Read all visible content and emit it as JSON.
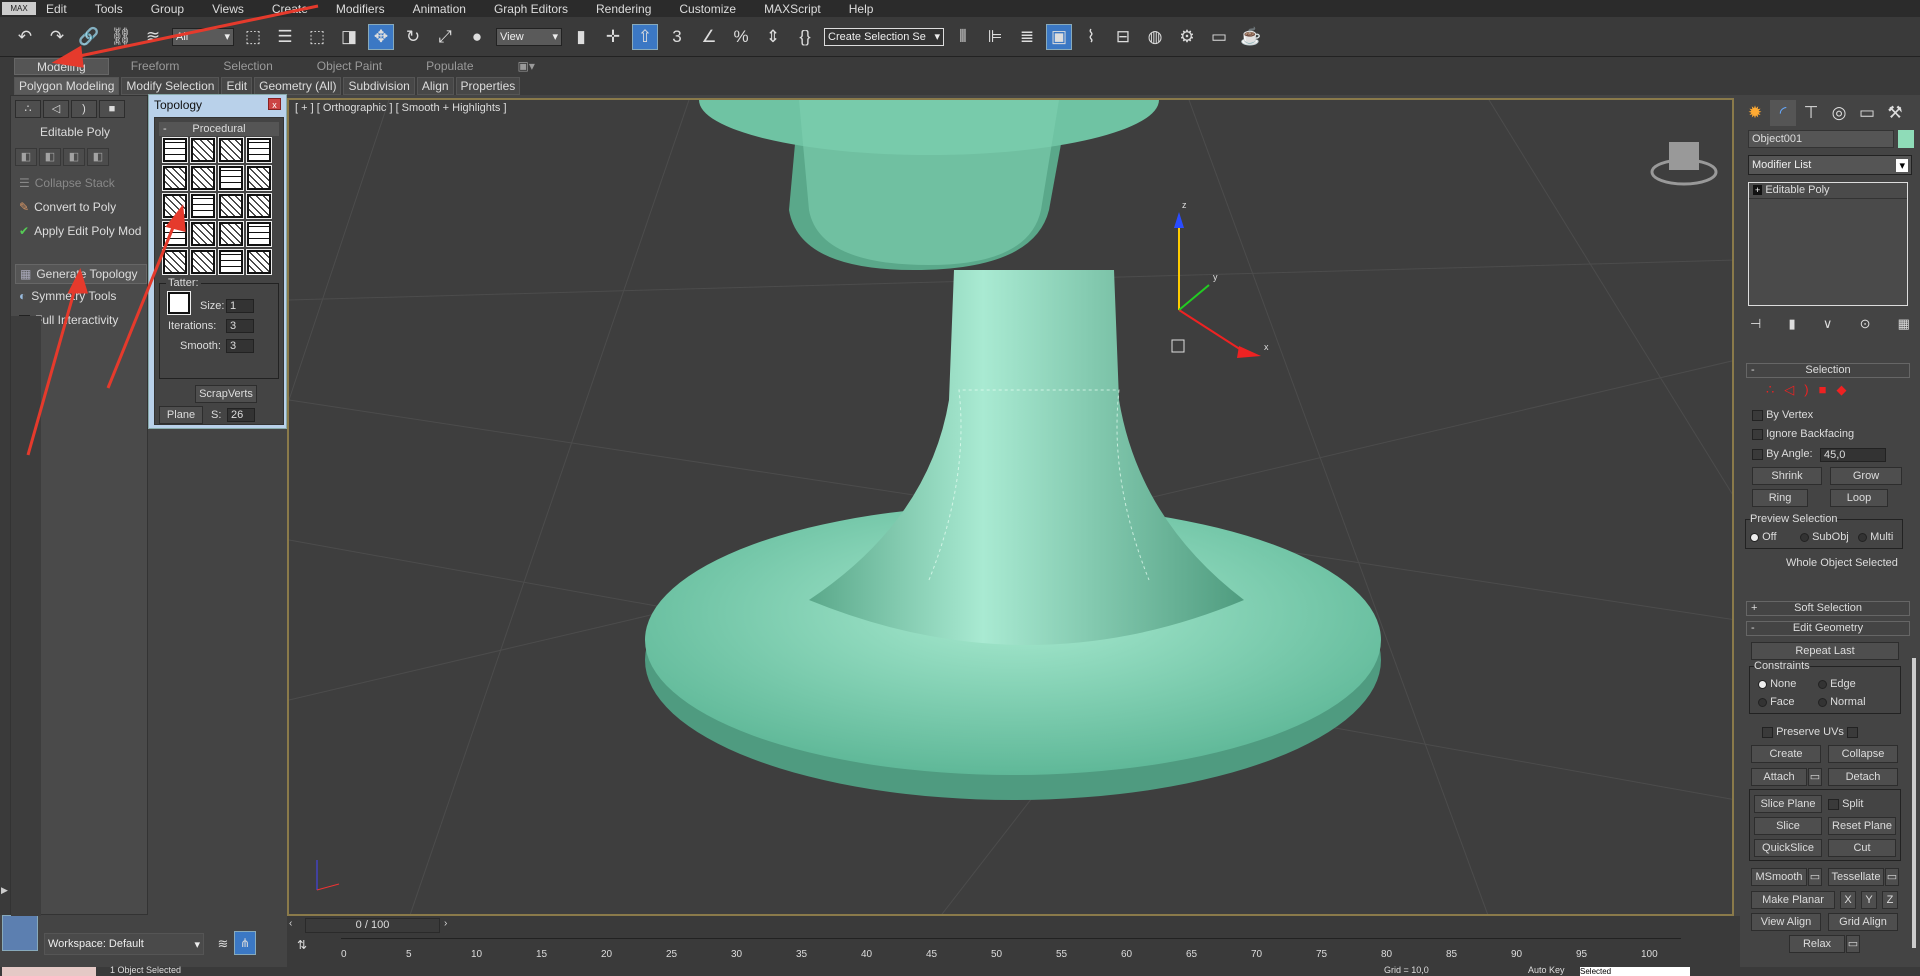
{
  "menubar": {
    "logo": "MAX",
    "items": [
      "Edit",
      "Tools",
      "Group",
      "Views",
      "Create",
      "Modifiers",
      "Animation",
      "Graph Editors",
      "Rendering",
      "Customize",
      "MAXScript",
      "Help"
    ]
  },
  "toolbar": {
    "filter_value": "All",
    "coord_value": "View",
    "selection_set_placeholder": "Create Selection Se"
  },
  "ribbon": {
    "tabs": [
      "Modeling",
      "Freeform",
      "Selection",
      "Object Paint",
      "Populate"
    ],
    "active_tab": "Modeling",
    "subtabs": [
      "Polygon Modeling",
      "Modify Selection",
      "Edit",
      "Geometry (All)",
      "Subdivision",
      "Align",
      "Properties"
    ]
  },
  "left_panel": {
    "title": "Editable Poly",
    "items": [
      "Collapse Stack",
      "Convert to Poly",
      "Apply Edit Poly Mod",
      "Generate Topology",
      "Symmetry Tools",
      "Full Interactivity"
    ],
    "full_interactivity_checked": true,
    "workspace": "Workspace: Default"
  },
  "topology": {
    "title": "Topology",
    "close": "x",
    "section": "Procedural",
    "section_toggle": "-",
    "tatter_label": "Tatter:",
    "size_label": "Size:",
    "size": "1",
    "iterations_label": "Iterations:",
    "iterations": "3",
    "smooth_label": "Smooth:",
    "smooth": "3",
    "scrapverts": "ScrapVerts",
    "plane": "Plane",
    "s_label": "S:",
    "s_value": "26"
  },
  "viewport": {
    "label": "[ + ] [ Orthographic ] [ Smooth + Highlights ]",
    "object_color": "#7fd0b0",
    "axis_z": "z",
    "axis_y": "y",
    "axis_x": "x"
  },
  "command_panel": {
    "object_name": "Object001",
    "object_color": "#8fdcb8",
    "modifier_list": "Modifier List",
    "stack_item": "Editable Poly",
    "stack_toggle": "+",
    "selection": {
      "title": "Selection",
      "toggle": "-",
      "by_vertex": "By Vertex",
      "ignore_backfacing": "Ignore Backfacing",
      "by_angle": "By Angle:",
      "angle": "45,0",
      "shrink": "Shrink",
      "grow": "Grow",
      "ring": "Ring",
      "loop": "Loop",
      "preview_title": "Preview Selection",
      "preview_options": [
        "Off",
        "SubObj",
        "Multi"
      ],
      "preview_selected": "Off",
      "status": "Whole Object Selected"
    },
    "soft_selection": {
      "title": "Soft Selection",
      "toggle": "+"
    },
    "edit_geometry": {
      "title": "Edit Geometry",
      "toggle": "-",
      "repeat_last": "Repeat Last",
      "constraints_title": "Constraints",
      "constraints": [
        "None",
        "Edge",
        "Face",
        "Normal"
      ],
      "constraint_selected": "None",
      "preserve_uvs": "Preserve UVs",
      "create": "Create",
      "collapse": "Collapse",
      "attach": "Attach",
      "detach": "Detach",
      "slice_plane": "Slice Plane",
      "split": "Split",
      "slice": "Slice",
      "reset_plane": "Reset Plane",
      "quickslice": "QuickSlice",
      "cut": "Cut",
      "msmooth": "MSmooth",
      "tessellate": "Tessellate",
      "make_planar": "Make Planar",
      "x": "X",
      "y": "Y",
      "z": "Z",
      "view_align": "View Align",
      "grid_align": "Grid Align",
      "relax": "Relax"
    }
  },
  "timeline": {
    "frame": "0 / 100",
    "ticks": [
      "0",
      "5",
      "10",
      "15",
      "20",
      "25",
      "30",
      "35",
      "40",
      "45",
      "50",
      "55",
      "60",
      "65",
      "70",
      "75",
      "80",
      "85",
      "90",
      "95",
      "100"
    ]
  },
  "status": {
    "selected": "1 Object Selected",
    "grid": "Grid = 10,0",
    "auto_key": "Auto Key",
    "key_mode": "Selected"
  }
}
